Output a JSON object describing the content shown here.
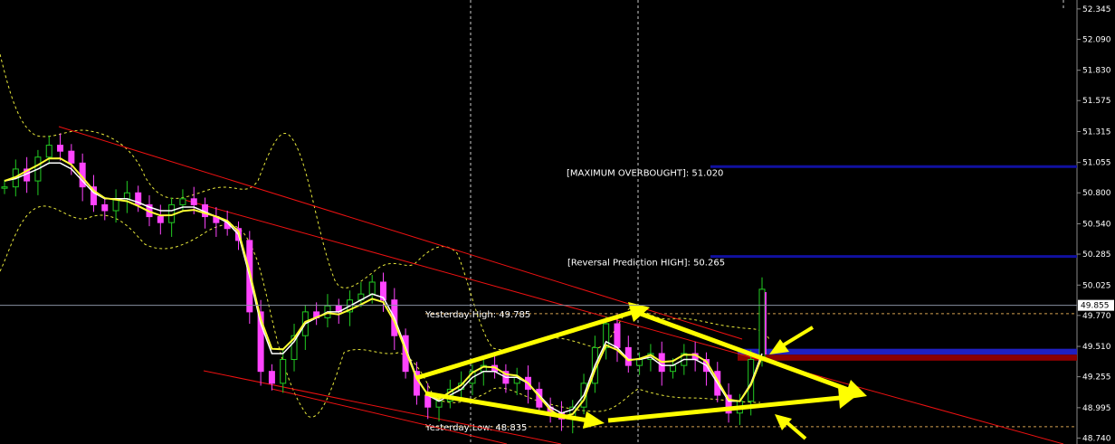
{
  "chart_data": {
    "type": "candlestick",
    "price_axis": {
      "ticks": [
        "52.345",
        "52.090",
        "51.830",
        "51.575",
        "51.315",
        "51.055",
        "50.800",
        "50.540",
        "50.285",
        "50.025",
        "49.770",
        "49.510",
        "49.255",
        "48.995",
        "48.740"
      ],
      "current_price": "49.855",
      "range": [
        48.69,
        52.42
      ]
    },
    "levels": [
      {
        "label": "[MAXIMUM OVERBOUGHT]: 51.020",
        "value": 51.02,
        "color": "#1010a0"
      },
      {
        "label": "[Reversal Prediction HIGH]: 50.265",
        "value": 50.265,
        "color": "#1010a0"
      },
      {
        "label": "Yesterday High: 49.785",
        "value": 49.785,
        "color": "#ffffff"
      },
      {
        "label": "Yesterday Low: 48.835",
        "value": 48.835,
        "color": "#ffffff"
      }
    ],
    "zones": [
      {
        "name": "blue-zone",
        "from": 49.44,
        "to": 49.49,
        "color": "#2020c0"
      },
      {
        "name": "red-zone",
        "from": 49.39,
        "to": 49.44,
        "color": "#8b0000"
      }
    ],
    "series": [
      {
        "name": "price",
        "color": "#22cc22",
        "values": [
          50.85,
          51.0,
          50.9,
          51.1,
          51.2,
          51.15,
          51.05,
          50.85,
          50.7,
          50.65,
          50.75,
          50.8,
          50.7,
          50.6,
          50.55,
          50.7,
          50.75,
          50.7,
          50.6,
          50.55,
          50.5,
          50.4,
          49.8,
          49.3,
          49.2,
          49.4,
          49.6,
          49.8,
          49.75,
          49.85,
          49.8,
          49.9,
          49.95,
          50.05,
          49.9,
          49.6,
          49.3,
          49.1,
          49.0,
          49.05,
          49.15,
          49.2,
          49.3,
          49.35,
          49.3,
          49.2,
          49.25,
          49.15,
          49.0,
          48.95,
          48.9,
          49.0,
          49.2,
          49.5,
          49.7,
          49.5,
          49.35,
          49.4,
          49.45,
          49.3,
          49.35,
          49.45,
          49.4,
          49.3,
          49.1,
          48.95,
          49.05,
          49.4,
          49.99
        ]
      },
      {
        "name": "moving-average",
        "color": "#ffffff",
        "values": [
          50.9,
          50.92,
          50.96,
          51.0,
          51.05,
          51.05,
          51.0,
          50.9,
          50.8,
          50.75,
          50.75,
          50.75,
          50.72,
          50.68,
          50.65,
          50.65,
          50.68,
          50.68,
          50.64,
          50.6,
          50.55,
          50.45,
          50.1,
          49.7,
          49.45,
          49.45,
          49.55,
          49.7,
          49.75,
          49.8,
          49.8,
          49.85,
          49.9,
          49.95,
          49.92,
          49.75,
          49.5,
          49.25,
          49.1,
          49.05,
          49.1,
          49.15,
          49.25,
          49.3,
          49.3,
          49.25,
          49.25,
          49.2,
          49.1,
          49.0,
          48.95,
          48.98,
          49.1,
          49.35,
          49.55,
          49.5,
          49.4,
          49.4,
          49.42,
          49.35,
          49.35,
          49.4,
          49.4,
          49.35,
          49.2,
          49.05,
          49.05,
          49.2,
          49.45
        ]
      }
    ],
    "xlabel": "",
    "ylabel": ""
  }
}
